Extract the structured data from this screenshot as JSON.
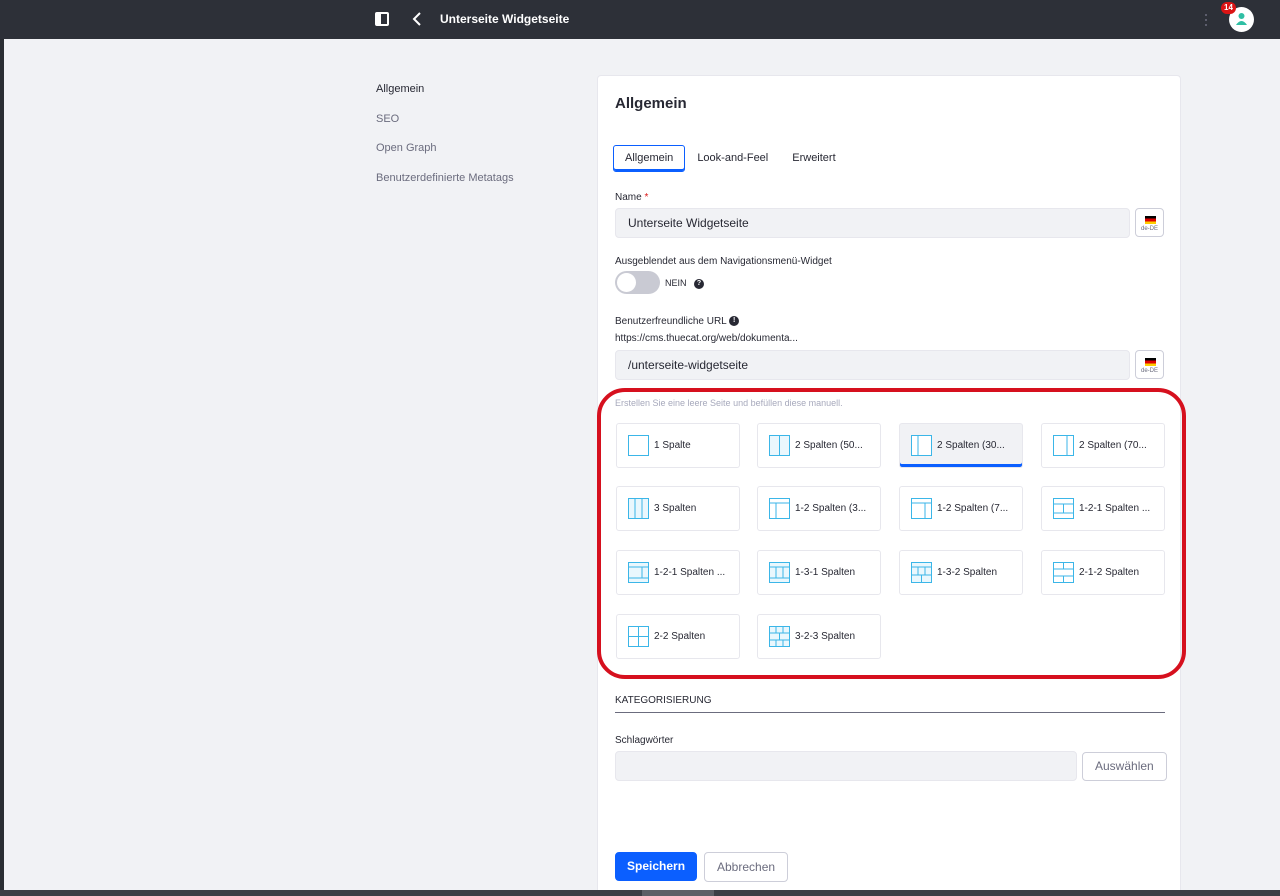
{
  "header": {
    "title": "Unterseite Widgetseite",
    "notification_count": "14"
  },
  "sidenav": {
    "items": [
      "Allgemein",
      "SEO",
      "Open Graph",
      "Benutzerdefinierte Metatags"
    ]
  },
  "form": {
    "heading": "Allgemein",
    "tabs": [
      "Allgemein",
      "Look-and-Feel",
      "Erweitert"
    ],
    "name": {
      "label": "Name",
      "required_marker": "*",
      "value": "Unterseite Widgetseite",
      "lang": "de-DE"
    },
    "hidden_toggle": {
      "label": "Ausgeblendet aus dem Navigationsmenü-Widget",
      "state": "NEIN"
    },
    "friendly_url": {
      "label": "Benutzerfreundliche URL",
      "base": "https://cms.thuecat.org/web/dokumenta...",
      "value": "/unterseite-widgetseite",
      "lang": "de-DE"
    },
    "template_hint": "Erstellen Sie eine leere Seite und befüllen diese manuell.",
    "layouts": [
      "1 Spalte",
      "2 Spalten (50...",
      "2 Spalten (30...",
      "2 Spalten (70...",
      "3 Spalten",
      "1-2 Spalten (3...",
      "1-2 Spalten (7...",
      "1-2-1 Spalten ...",
      "1-2-1 Spalten ...",
      "1-3-1 Spalten",
      "1-3-2 Spalten",
      "2-1-2 Spalten",
      "2-2 Spalten",
      "3-2-3 Spalten"
    ],
    "selected_layout": "2 Spalten (30...",
    "categorization": {
      "heading": "KATEGORISIERUNG",
      "tags_label": "Schlagwörter",
      "select_button": "Auswählen"
    },
    "save_button": "Speichern",
    "cancel_button": "Abbrechen"
  },
  "colors": {
    "primary": "#0b5fff",
    "highlight": "#d6101e",
    "layout_icon": "#3bb6e8"
  }
}
